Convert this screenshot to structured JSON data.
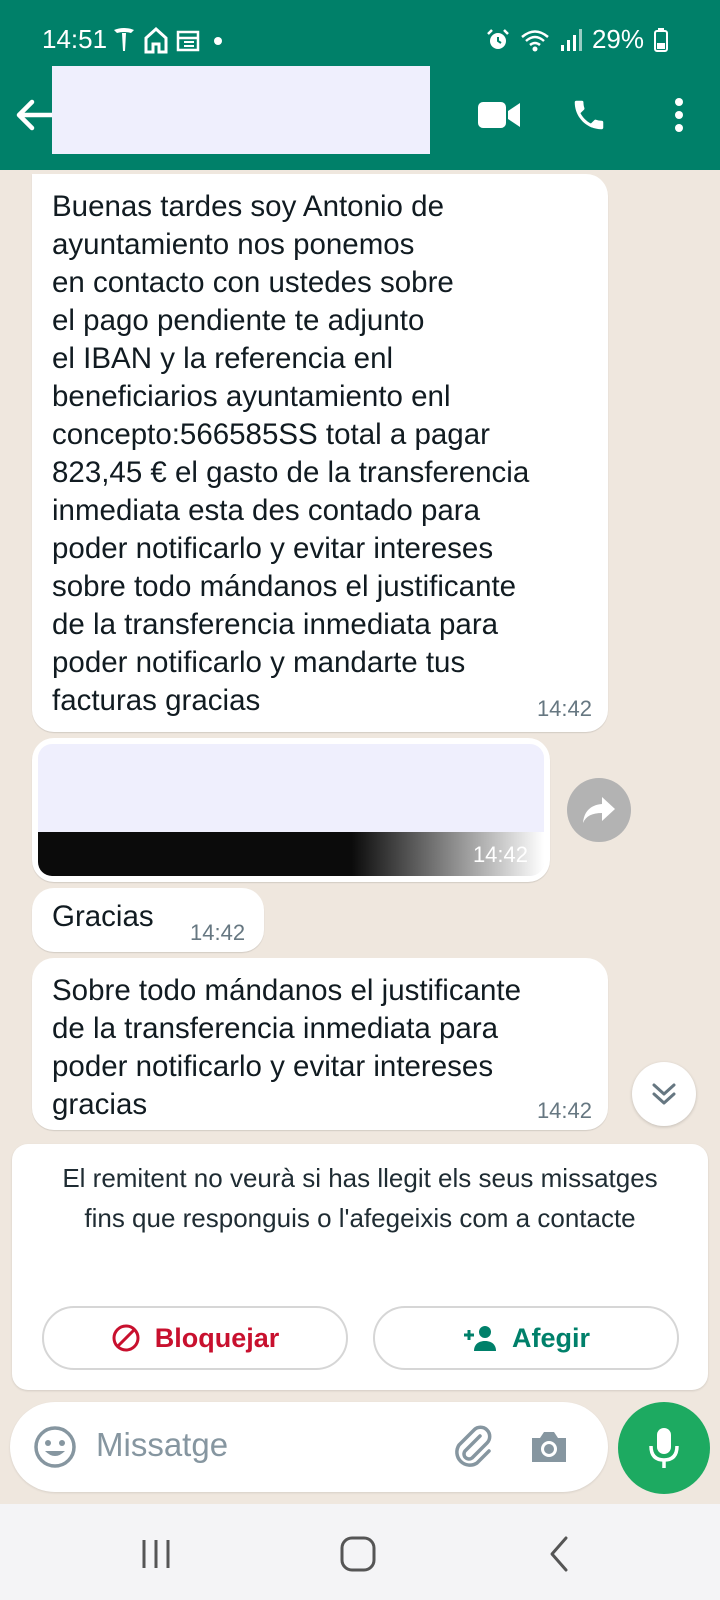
{
  "status_bar": {
    "time": "14:51",
    "battery": "29%",
    "left_icons": [
      "tesla-icon",
      "home-icon",
      "calendar-icon",
      "dot-icon"
    ],
    "right_icons": [
      "alarm-icon",
      "wifi-icon",
      "signal-icon",
      "battery-icon"
    ]
  },
  "header": {
    "contact_name": "",
    "icons": [
      "back-arrow-icon",
      "video-call-icon",
      "phone-icon",
      "more-vert-icon"
    ],
    "color": "#008069"
  },
  "messages": [
    {
      "text": "Buenas tardes soy Antonio de\nayuntamiento nos ponemos\nen contacto con ustedes sobre\nel pago pendiente te adjunto\nel IBAN y la referencia enl\nbeneficiarios ayuntamiento enl\nconcepto:566585SS total a pagar\n823,45 € el gasto de la transferencia\ninmediata esta des contado para\npoder notificarlo y evitar intereses\nsobre todo mándanos el justificante\nde la transferencia inmediata para\npoder notificarlo y mandarte tus\nfacturas gracias",
      "time": "14:42"
    },
    {
      "type": "media",
      "time": "14:42"
    },
    {
      "text": "Gracias",
      "time": "14:42"
    },
    {
      "text": "Sobre todo mándanos el justificante\nde la transferencia inmediata para\npoder notificarlo y evitar intereses\ngracias",
      "time": "14:42"
    }
  ],
  "unknown_sender": {
    "notice": "El remitent no veurà si has llegit els seus missatges fins que responguis o l'afegeixis com a contacte",
    "block_label": "Bloquejar",
    "add_label": "Afegir",
    "block_color": "#c8102e",
    "add_color": "#00806a"
  },
  "composer": {
    "placeholder": "Missatge",
    "mic_color": "#1daa61"
  },
  "navbar": {
    "icons": [
      "recents-icon",
      "home-button-icon",
      "back-nav-icon"
    ]
  }
}
